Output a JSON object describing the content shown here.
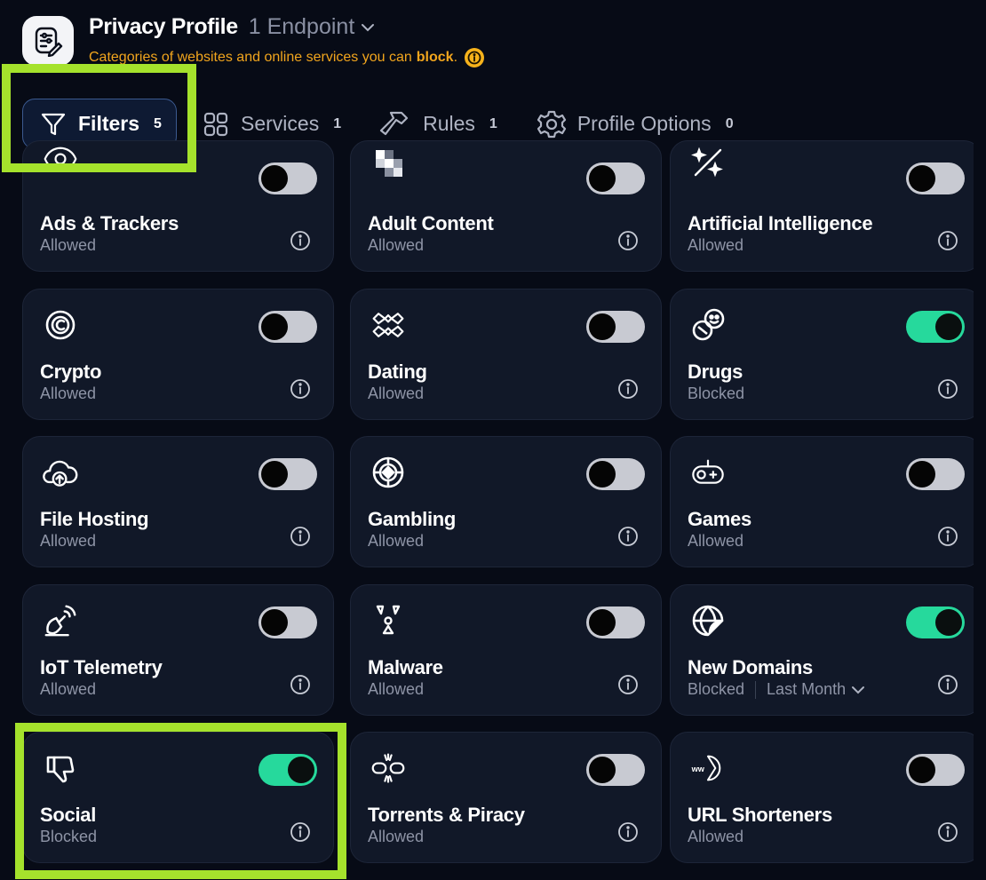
{
  "header": {
    "title": "Privacy Profile",
    "endpoint_selector": "1 Endpoint",
    "subtitle_prefix": "Categories of websites and online services you can",
    "subtitle_emphasis": "block",
    "subtitle_suffix": "."
  },
  "tabs": [
    {
      "label": "Filters",
      "count": "5",
      "icon": "filter-funnel-icon",
      "active": true
    },
    {
      "label": "Services",
      "count": "1",
      "icon": "grid-four-icon",
      "active": false
    },
    {
      "label": "Rules",
      "count": "1",
      "icon": "hammer-icon",
      "active": false
    },
    {
      "label": "Profile Options",
      "count": "0",
      "icon": "gear-icon",
      "active": false
    }
  ],
  "categories": [
    {
      "name": "Ads & Trackers",
      "status": "Allowed",
      "enabled": false,
      "icon": "eye-icon"
    },
    {
      "name": "Adult Content",
      "status": "Allowed",
      "enabled": false,
      "icon": "pixelated-icon"
    },
    {
      "name": "Artificial Intelligence",
      "status": "Allowed",
      "enabled": false,
      "icon": "sparkle-wand-icon"
    },
    {
      "name": "Crypto",
      "status": "Allowed",
      "enabled": false,
      "icon": "coin-icon"
    },
    {
      "name": "Dating",
      "status": "Allowed",
      "enabled": false,
      "icon": "fish-kiss-icon"
    },
    {
      "name": "Drugs",
      "status": "Blocked",
      "enabled": true,
      "icon": "pills-icon"
    },
    {
      "name": "File Hosting",
      "status": "Allowed",
      "enabled": false,
      "icon": "cloud-upload-icon"
    },
    {
      "name": "Gambling",
      "status": "Allowed",
      "enabled": false,
      "icon": "poker-chip-icon"
    },
    {
      "name": "Games",
      "status": "Allowed",
      "enabled": false,
      "icon": "gamepad-icon"
    },
    {
      "name": "IoT Telemetry",
      "status": "Allowed",
      "enabled": false,
      "icon": "satellite-dish-icon"
    },
    {
      "name": "Malware",
      "status": "Allowed",
      "enabled": false,
      "icon": "radiation-icon"
    },
    {
      "name": "New Domains",
      "status": "Blocked",
      "enabled": true,
      "icon": "globe-sticker-icon",
      "period": "Last Month"
    },
    {
      "name": "Social",
      "status": "Blocked",
      "enabled": true,
      "icon": "thumbs-down-icon"
    },
    {
      "name": "Torrents & Piracy",
      "status": "Allowed",
      "enabled": false,
      "icon": "broken-link-icon"
    },
    {
      "name": "URL Shorteners",
      "status": "Allowed",
      "enabled": false,
      "icon": "www-pacman-icon"
    }
  ],
  "colors": {
    "background": "#070b16",
    "card": "#111828",
    "toggle_on": "#26d99c",
    "toggle_off": "#c8cad2",
    "warning": "#f1a51d",
    "annotation_highlight": "#a5e22c"
  }
}
